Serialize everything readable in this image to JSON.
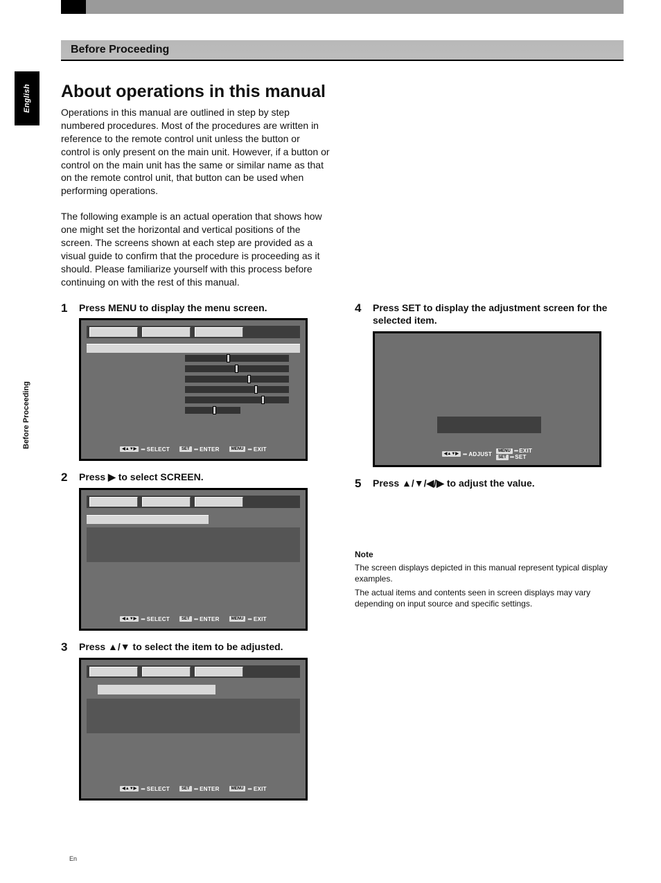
{
  "side_tabs": {
    "language": "English",
    "section": "Before Proceeding"
  },
  "header": {
    "title": "Before Proceeding"
  },
  "main": {
    "heading": "About operations in this manual",
    "intro1": "Operations in this manual are outlined in step by step numbered procedures. Most of the procedures are written in reference to the remote control unit unless the button or control is only present on the main unit. However, if a button or control on the main unit has the same or similar name as that on the remote control unit, that button can be used when performing operations.",
    "intro2": "The following example is an actual operation that shows how one might set the horizontal and vertical positions of the screen. The screens shown at each step are provided as a visual guide to confirm that the procedure is proceeding as it should. Please familiarize yourself with this process before continuing on with the rest of this manual."
  },
  "steps": {
    "s1": {
      "num": "1",
      "title": "Press MENU to display the menu screen."
    },
    "s2": {
      "num": "2",
      "title": "Press ▶ to select SCREEN."
    },
    "s3": {
      "num": "3",
      "title": "Press ▲/▼ to select the item to be adjusted."
    },
    "s4": {
      "num": "4",
      "title": "Press SET to display the adjustment screen for the selected item."
    },
    "s5": {
      "num": "5",
      "title": "Press ▲/▼/◀/▶ to adjust the value."
    }
  },
  "hints": {
    "nav": "◀▲▼▶",
    "select": "SELECT",
    "adjust": "ADJUST",
    "set": "SET",
    "enter": "ENTER",
    "menu": "MENU",
    "exit": "EXIT",
    "dots": "•••"
  },
  "note": {
    "heading": "Note",
    "p1": "The screen displays depicted in this manual represent typical display examples.",
    "p2": "The actual items and contents seen in screen displays may vary depending on input source and specific settings."
  },
  "footer": {
    "lang": "En"
  }
}
